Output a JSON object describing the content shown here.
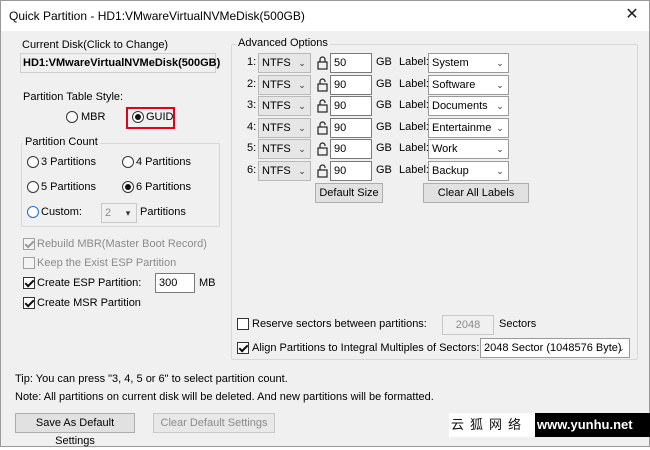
{
  "window": {
    "title": "Quick Partition - HD1:VMwareVirtualNVMeDisk(500GB)",
    "close_glyph": "✕"
  },
  "current_disk": {
    "label": "Current Disk(Click to Change)",
    "value": "HD1:VMwareVirtualNVMeDisk(500GB)"
  },
  "partition_table": {
    "label": "Partition Table Style:",
    "mbr": "MBR",
    "guid": "GUID",
    "selected": "GUID"
  },
  "partition_count": {
    "label": "Partition Count",
    "opt3": "3 Partitions",
    "opt4": "4 Partitions",
    "opt5": "5 Partitions",
    "opt6": "6 Partitions",
    "custom": "Custom:",
    "custom_value": "2",
    "custom_suffix": "Partitions",
    "selected": "6 Partitions"
  },
  "options": {
    "rebuild_mbr": "Rebuild MBR(Master Boot Record)",
    "keep_esp": "Keep the Exist ESP Partition",
    "create_esp": "Create ESP Partition:",
    "esp_size": "300",
    "esp_unit": "MB",
    "create_msr": "Create MSR Partition"
  },
  "advanced": {
    "label": "Advanced Options",
    "unit": "GB",
    "label_text": "Label:",
    "rows": [
      {
        "num": "1:",
        "fs": "NTFS",
        "size": "50",
        "label": "System",
        "locked": true
      },
      {
        "num": "2:",
        "fs": "NTFS",
        "size": "90",
        "label": "Software",
        "locked": false
      },
      {
        "num": "3:",
        "fs": "NTFS",
        "size": "90",
        "label": "Documents",
        "locked": false
      },
      {
        "num": "4:",
        "fs": "NTFS",
        "size": "90",
        "label": "Entertainmen",
        "locked": false
      },
      {
        "num": "5:",
        "fs": "NTFS",
        "size": "90",
        "label": "Work",
        "locked": false
      },
      {
        "num": "6:",
        "fs": "NTFS",
        "size": "90",
        "label": "Backup",
        "locked": false
      }
    ],
    "default_size": "Default Size",
    "clear_labels": "Clear All Labels",
    "reserve_sectors": "Reserve sectors between partitions:",
    "reserve_value": "2048",
    "reserve_unit": "Sectors",
    "align": "Align Partitions to Integral Multiples of Sectors:",
    "align_value": "2048 Sector (1048576 Byte)"
  },
  "tips": {
    "tip": "Tip:  You can press \"3, 4, 5 or 6\" to select partition count.",
    "note": "Note: All partitions on current disk will be deleted. And new partitions will be formatted."
  },
  "buttons": {
    "save_default": "Save As Default Settings",
    "clear_default": "Clear Default Settings"
  },
  "watermark": {
    "zh": "云狐网络",
    "url": "www.yunhu.net"
  },
  "colors": {
    "highlight_red": "#e3001b",
    "accent_blue": "#1c6dd0"
  }
}
